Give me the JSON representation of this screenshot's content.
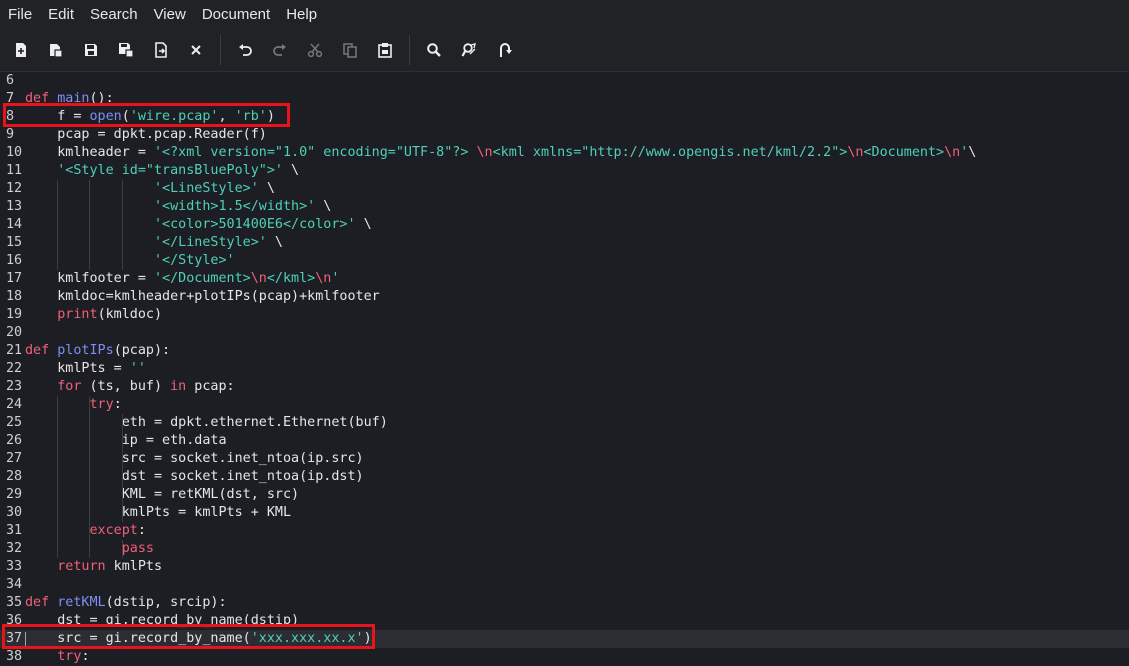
{
  "menu": [
    "File",
    "Edit",
    "Search",
    "View",
    "Document",
    "Help"
  ],
  "toolbar": [
    "new-file-icon",
    "open-file-icon",
    "save-icon",
    "save-as-icon",
    "reload-icon",
    "close-icon",
    "undo-icon",
    "redo-icon",
    "cut-icon",
    "copy-icon",
    "paste-icon",
    "search-icon",
    "find-replace-icon",
    "goto-line-icon"
  ],
  "colors": {
    "keyword": "#f25f78",
    "function": "#7d8ff2",
    "string": "#4fd0b7",
    "highlight": "#e8141c"
  },
  "current_line": 37,
  "lines": [
    {
      "n": "6",
      "c": []
    },
    {
      "n": "7",
      "c": [
        [
          "k",
          "def"
        ],
        [
          "",
          " "
        ],
        [
          "f",
          "main"
        ],
        [
          "",
          "():"
        ]
      ]
    },
    {
      "n": "8",
      "c": [
        [
          "",
          "    f = "
        ],
        [
          "f",
          "open"
        ],
        [
          "",
          "("
        ],
        [
          "s",
          "'wire.pcap'"
        ],
        [
          "",
          ", "
        ],
        [
          "s",
          "'rb'"
        ],
        [
          "",
          ")"
        ]
      ]
    },
    {
      "n": "9",
      "c": [
        [
          "",
          "    pcap = dpkt.pcap.Reader(f)"
        ]
      ]
    },
    {
      "n": "10",
      "c": [
        [
          "",
          "    kmlheader = "
        ],
        [
          "s",
          "'<?xml version=\"1.0\" encoding=\"UTF-8\"?> "
        ],
        [
          "e",
          "\\n"
        ],
        [
          "s",
          "<kml xmlns=\"http://www.opengis.net/kml/2.2\">"
        ],
        [
          "e",
          "\\n"
        ],
        [
          "s",
          "<Document>"
        ],
        [
          "e",
          "\\n"
        ],
        [
          "s",
          "'"
        ],
        [
          "",
          "\\"
        ]
      ]
    },
    {
      "n": "11",
      "c": [
        [
          "",
          "    "
        ],
        [
          "s",
          "'<Style id=\"transBluePoly\">'"
        ],
        [
          "",
          " \\"
        ]
      ]
    },
    {
      "n": "12",
      "c": [
        [
          "",
          "                "
        ],
        [
          "s",
          "'<LineStyle>'"
        ],
        [
          "",
          " \\"
        ]
      ]
    },
    {
      "n": "13",
      "c": [
        [
          "",
          "                "
        ],
        [
          "s",
          "'<width>1.5</width>'"
        ],
        [
          "",
          " \\"
        ]
      ]
    },
    {
      "n": "14",
      "c": [
        [
          "",
          "                "
        ],
        [
          "s",
          "'<color>501400E6</color>'"
        ],
        [
          "",
          " \\"
        ]
      ]
    },
    {
      "n": "15",
      "c": [
        [
          "",
          "                "
        ],
        [
          "s",
          "'</LineStyle>'"
        ],
        [
          "",
          " \\"
        ]
      ]
    },
    {
      "n": "16",
      "c": [
        [
          "",
          "                "
        ],
        [
          "s",
          "'</Style>'"
        ]
      ]
    },
    {
      "n": "17",
      "c": [
        [
          "",
          "    kmlfooter = "
        ],
        [
          "s",
          "'</Document>"
        ],
        [
          "e",
          "\\n"
        ],
        [
          "s",
          "</kml>"
        ],
        [
          "e",
          "\\n"
        ],
        [
          "s",
          "'"
        ]
      ]
    },
    {
      "n": "18",
      "c": [
        [
          "",
          "    kmldoc=kmlheader+plotIPs(pcap)+kmlfooter"
        ]
      ]
    },
    {
      "n": "19",
      "c": [
        [
          "",
          "    "
        ],
        [
          "k",
          "print"
        ],
        [
          "",
          "(kmldoc)"
        ]
      ]
    },
    {
      "n": "20",
      "c": []
    },
    {
      "n": "21",
      "c": [
        [
          "k",
          "def"
        ],
        [
          "",
          " "
        ],
        [
          "f",
          "plotIPs"
        ],
        [
          "",
          "(pcap):"
        ]
      ]
    },
    {
      "n": "22",
      "c": [
        [
          "",
          "    kmlPts = "
        ],
        [
          "s",
          "''"
        ]
      ]
    },
    {
      "n": "23",
      "c": [
        [
          "",
          "    "
        ],
        [
          "k",
          "for"
        ],
        [
          "",
          " (ts, buf) "
        ],
        [
          "k",
          "in"
        ],
        [
          "",
          " pcap:"
        ]
      ]
    },
    {
      "n": "24",
      "c": [
        [
          "",
          "        "
        ],
        [
          "k",
          "try"
        ],
        [
          "",
          ":"
        ]
      ]
    },
    {
      "n": "25",
      "c": [
        [
          "",
          "            eth = dpkt.ethernet.Ethernet(buf)"
        ]
      ]
    },
    {
      "n": "26",
      "c": [
        [
          "",
          "            ip = eth.data"
        ]
      ]
    },
    {
      "n": "27",
      "c": [
        [
          "",
          "            src = socket.inet_ntoa(ip.src)"
        ]
      ]
    },
    {
      "n": "28",
      "c": [
        [
          "",
          "            dst = socket.inet_ntoa(ip.dst)"
        ]
      ]
    },
    {
      "n": "29",
      "c": [
        [
          "",
          "            KML = retKML(dst, src)"
        ]
      ]
    },
    {
      "n": "30",
      "c": [
        [
          "",
          "            kmlPts = kmlPts + KML"
        ]
      ]
    },
    {
      "n": "31",
      "c": [
        [
          "",
          "        "
        ],
        [
          "k",
          "except"
        ],
        [
          "",
          ":"
        ]
      ]
    },
    {
      "n": "32",
      "c": [
        [
          "",
          "            "
        ],
        [
          "k",
          "pass"
        ]
      ]
    },
    {
      "n": "33",
      "c": [
        [
          "",
          "    "
        ],
        [
          "k",
          "return"
        ],
        [
          "",
          " kmlPts"
        ]
      ]
    },
    {
      "n": "34",
      "c": []
    },
    {
      "n": "35",
      "c": [
        [
          "k",
          "def"
        ],
        [
          "",
          " "
        ],
        [
          "f",
          "retKML"
        ],
        [
          "",
          "(dstip, srcip):"
        ]
      ]
    },
    {
      "n": "36",
      "c": [
        [
          "",
          "    dst = gi.record_by_name(dstip)"
        ]
      ]
    },
    {
      "n": "37",
      "c": [
        [
          "",
          "    src = gi.record_by_name("
        ],
        [
          "s",
          "'xxx.xxx.xx.x'"
        ],
        [
          "",
          ")"
        ]
      ]
    },
    {
      "n": "38",
      "c": [
        [
          "",
          "    "
        ],
        [
          "k",
          "try"
        ],
        [
          "",
          ":"
        ]
      ]
    }
  ]
}
